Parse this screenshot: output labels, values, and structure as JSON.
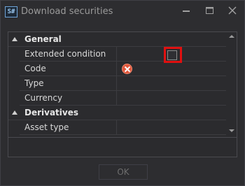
{
  "window": {
    "app_icon_text": "S#",
    "title": "Download securities"
  },
  "property_grid": {
    "rows": [
      {
        "kind": "category",
        "label": "General"
      },
      {
        "kind": "property",
        "label": "Extended condition",
        "value_type": "checkbox",
        "checked": false
      },
      {
        "kind": "property",
        "label": "Code",
        "value_type": "error"
      },
      {
        "kind": "property",
        "label": "Type",
        "value": ""
      },
      {
        "kind": "property",
        "label": "Currency",
        "value": ""
      },
      {
        "kind": "category",
        "label": "Derivatives"
      },
      {
        "kind": "property",
        "label": "Asset type",
        "value": ""
      }
    ]
  },
  "buttons": {
    "ok_label": "OK"
  },
  "colors": {
    "background": "#2d2d30",
    "highlight": "#e01010",
    "error": "#e0573c"
  }
}
